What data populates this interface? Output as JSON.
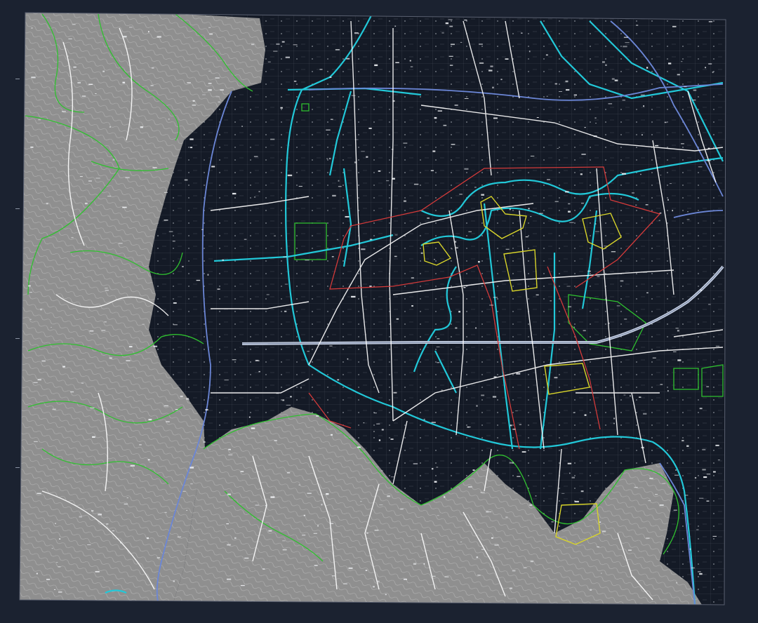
{
  "viewport": {
    "background": "#1b2230",
    "map_frame_color": "#5a6070"
  },
  "layers": {
    "terrain_fill": "#8f8f8f",
    "urban_fill": "#141a26",
    "contours": "#d9d9d9",
    "roads": "#ffffff",
    "highway": "#c9d3e6",
    "rivers": "#22c8d8",
    "railway": "#6b86d6",
    "boundary_green": "#2fc12f",
    "boundary_red": "#d43a3a",
    "boundary_yellow": "#d8d42a"
  }
}
